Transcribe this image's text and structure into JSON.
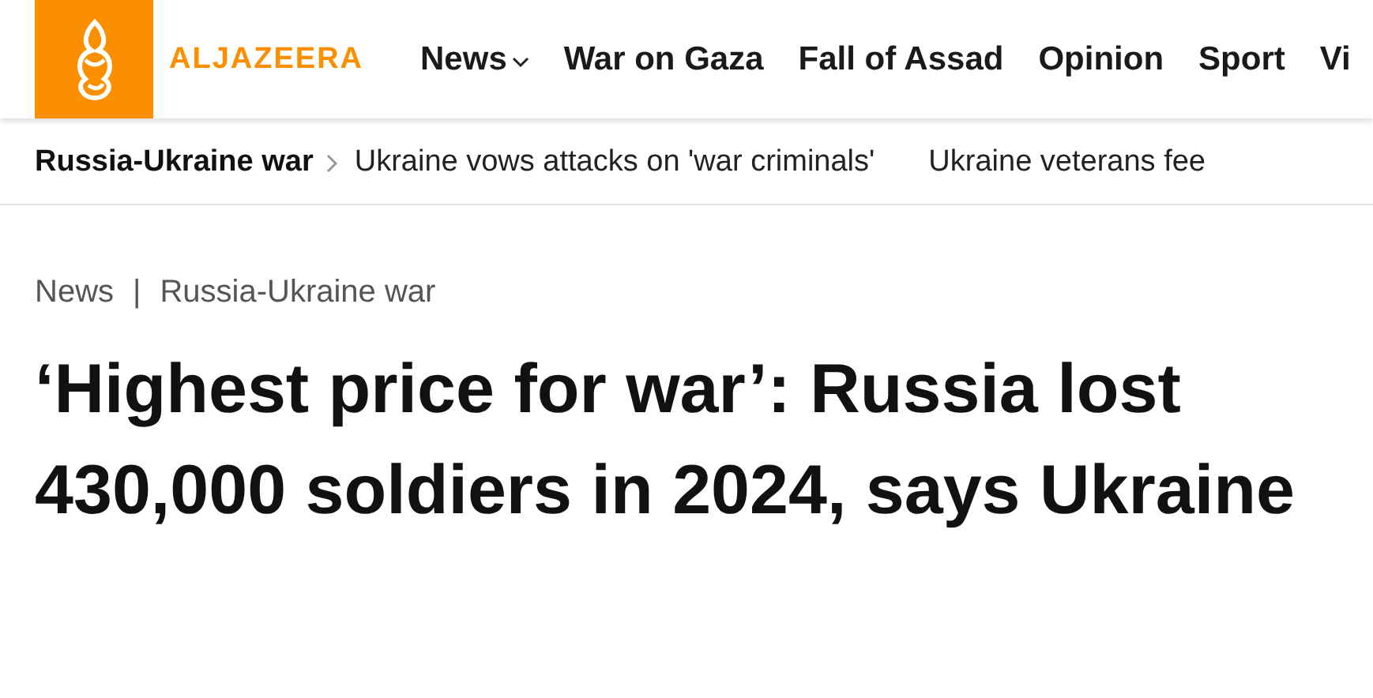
{
  "header": {
    "logo_text": "ALJAZEERA",
    "nav": [
      {
        "label": "News",
        "kind": "dropdown"
      },
      {
        "label": "War on Gaza",
        "kind": "link"
      },
      {
        "label": "Fall of Assad",
        "kind": "link"
      },
      {
        "label": "Opinion",
        "kind": "link"
      },
      {
        "label": "Sport",
        "kind": "link"
      },
      {
        "label": "Vi",
        "kind": "link"
      }
    ]
  },
  "topic_bar": {
    "topic": "Russia-Ukraine war",
    "stories": [
      "Ukraine vows attacks on 'war criminals'",
      "Ukraine veterans fee"
    ]
  },
  "article": {
    "breadcrumb": [
      "News",
      "Russia-Ukraine war"
    ],
    "separator": "|",
    "headline": "‘Highest price for war’: Russia lost 430,000 soldiers in 2024, says Ukraine"
  }
}
